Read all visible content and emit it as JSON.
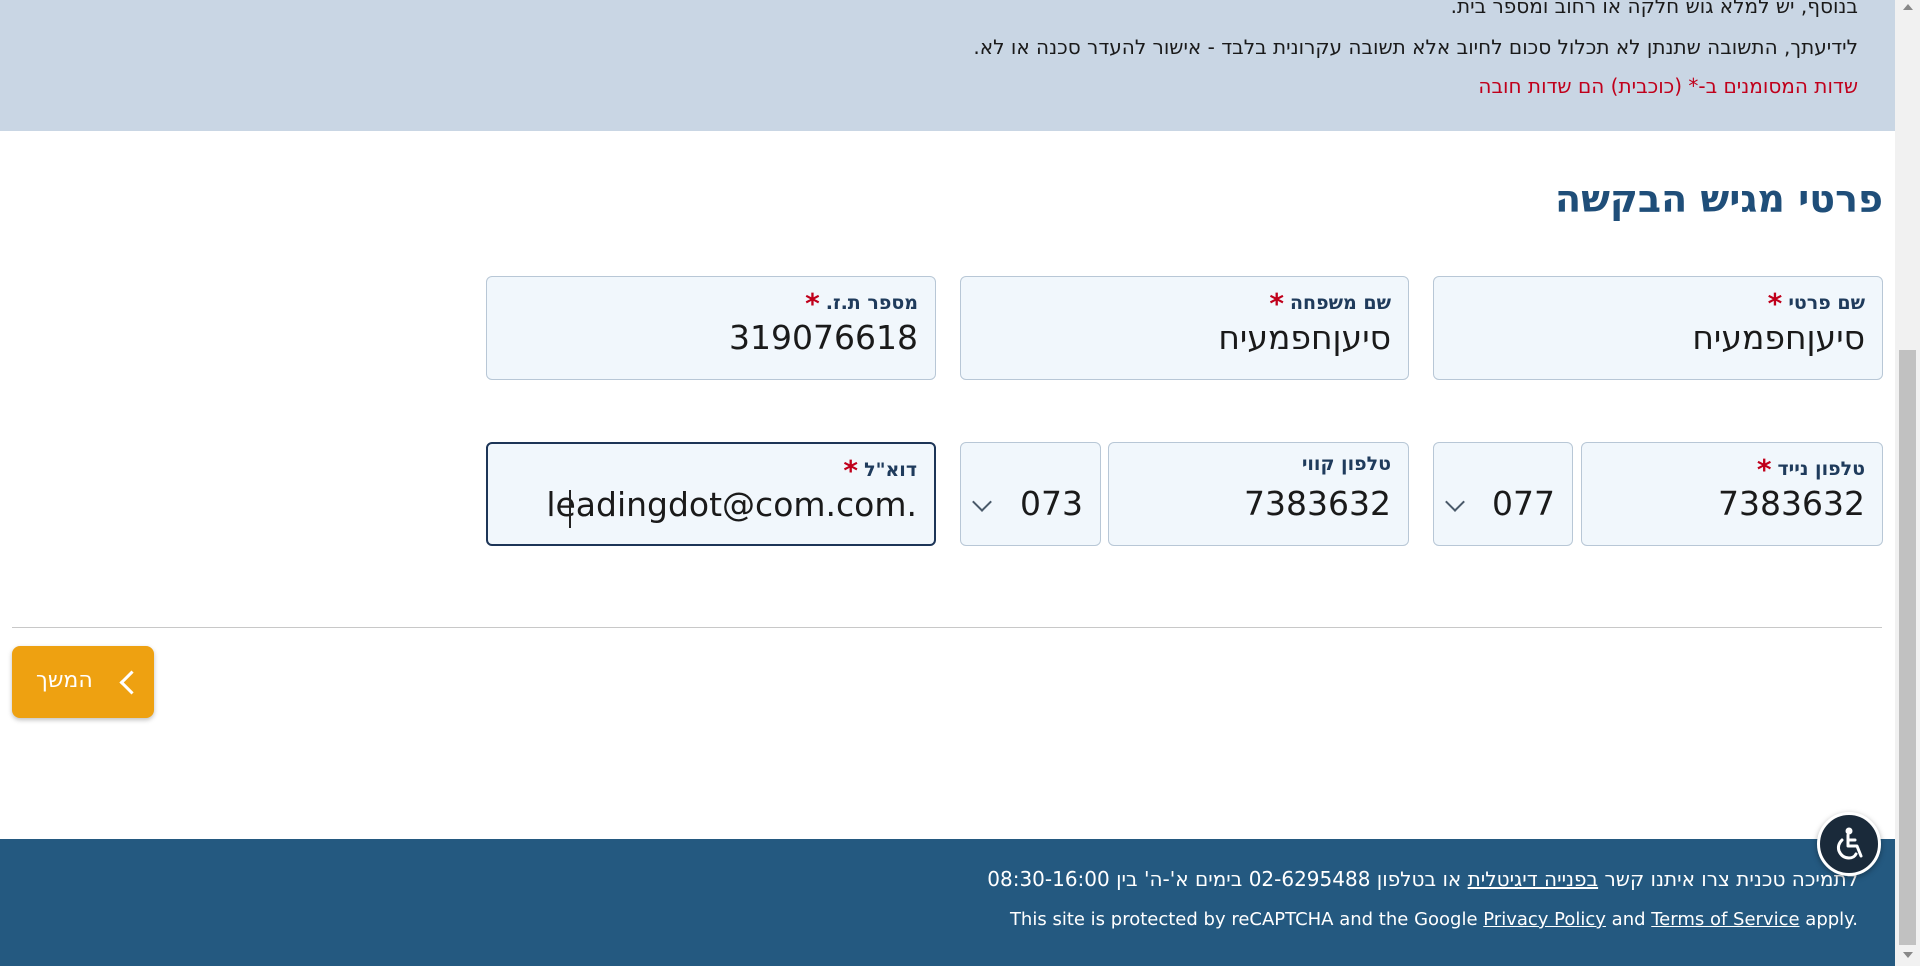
{
  "info": {
    "line1": "בנוסף, יש למלא גוש חלקה או רחוב ומספר בית.",
    "line2": "לידיעתך, התשובה שתנתן לא תכלול סכום לחיוב אלא תשובה עקרונית בלבד - אישור להעדר סכנה או לא.",
    "required_note": "שדות המסומנים ב-* (כוכבית) הם שדות חובה"
  },
  "section": {
    "title": "פרטי מגיש הבקשה"
  },
  "form": {
    "first_name": {
      "label": "שם פרטי",
      "value": "סיעןחפמעיח"
    },
    "last_name": {
      "label": "שם משפחה",
      "value": "סיעןחפמעיח"
    },
    "id_number": {
      "label": "מספר ת.ז.",
      "value": "319076618"
    },
    "mobile": {
      "label": "טלפון נייד",
      "value": "7383632",
      "prefix": "077"
    },
    "landline": {
      "label": "טלפון קווי",
      "value": "7383632",
      "prefix": "073"
    },
    "email": {
      "label": "דוא\"ל",
      "value": "leadingdot@com.com."
    },
    "required_mark": "*"
  },
  "actions": {
    "continue_label": "המשך"
  },
  "footer": {
    "support_prefix": "לתמיכה טכנית צרו איתנו קשר ",
    "support_link": "בפנייה דיגיטלית",
    "support_suffix": " או בטלפון 02-6295488 בימים א'-ה' בין 08:30-16:00",
    "recaptcha_prefix": "This site is protected by reCAPTCHA and the Google ",
    "privacy_link": "Privacy Policy",
    "and_text": " and ",
    "terms_link": "Terms of Service",
    "apply_text": " apply."
  },
  "colors": {
    "accent": "#eea111",
    "footer": "#245980",
    "required": "#c0001b",
    "title": "#1f4e79",
    "info_band": "#c9d6e4"
  },
  "icons": {
    "continue": "chevron-left-icon",
    "select": "chevron-down-icon",
    "accessibility": "accessibility-icon"
  }
}
